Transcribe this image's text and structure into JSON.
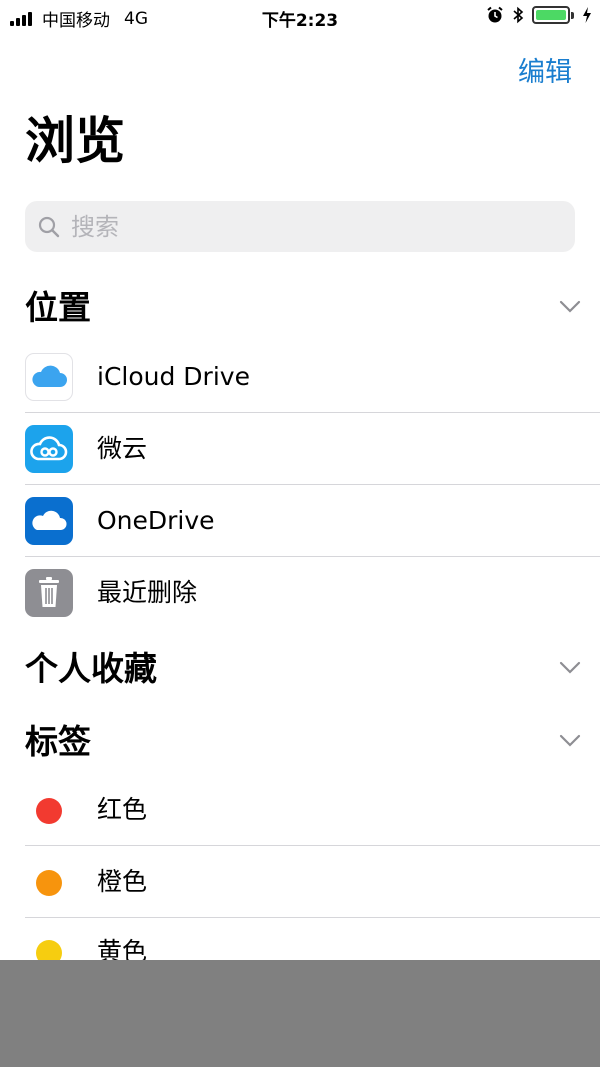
{
  "status_bar": {
    "carrier": "中国移动",
    "network": "4G",
    "time": "下午2:23"
  },
  "nav": {
    "edit_label": "编辑",
    "title": "浏览"
  },
  "search": {
    "placeholder": "搜索"
  },
  "sections": {
    "locations": {
      "title": "位置",
      "items": [
        {
          "label": "iCloud Drive",
          "icon": "icloud-icon"
        },
        {
          "label": "微云",
          "icon": "weiyun-icon"
        },
        {
          "label": "OneDrive",
          "icon": "onedrive-icon"
        },
        {
          "label": "最近删除",
          "icon": "trash-icon"
        }
      ]
    },
    "favorites": {
      "title": "个人收藏"
    },
    "tags": {
      "title": "标签",
      "items": [
        {
          "label": "红色",
          "color": "#f23a30"
        },
        {
          "label": "橙色",
          "color": "#f7940d"
        },
        {
          "label": "黄色",
          "color": "#f6cd10"
        }
      ]
    }
  },
  "colors": {
    "accent": "#1a7ecf",
    "icloud": "#3ba4ef",
    "weiyun": "#1ca3ec",
    "onedrive": "#0a6fcf",
    "trash": "#8e8e93"
  }
}
